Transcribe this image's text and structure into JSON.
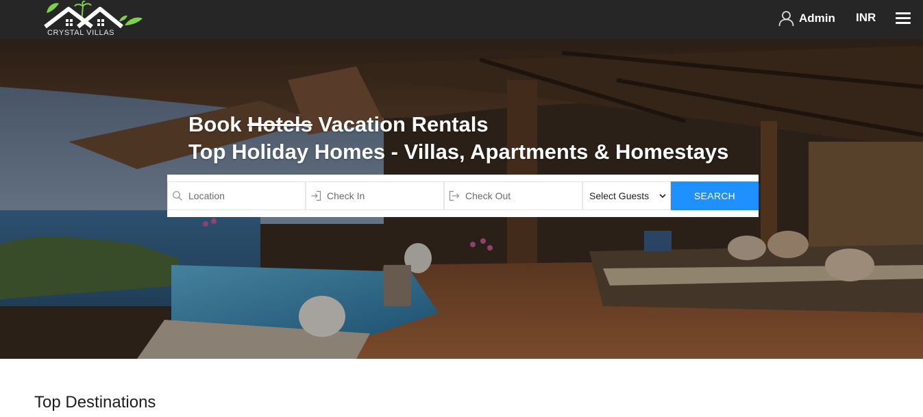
{
  "header": {
    "brand": "CRYSTAL VILLAS",
    "user_label": "Admin",
    "currency": "INR",
    "user_icon": "user-icon",
    "menu_icon": "hamburger-menu-icon"
  },
  "hero": {
    "title_word": "Book",
    "title_struck": "Hotels",
    "title_rest": "Vacation Rentals",
    "subtitle": "Top Holiday Homes - Villas, Apartments & Homestays"
  },
  "search": {
    "location_placeholder": "Location",
    "checkin_placeholder": "Check In",
    "checkout_placeholder": "Check Out",
    "guests_selected": "Select Guests",
    "button_label": "SEARCH",
    "location_icon": "search-icon",
    "checkin_icon": "sign-in-icon",
    "checkout_icon": "sign-out-icon"
  },
  "sections": {
    "top_destinations": "Top Destinations"
  },
  "colors": {
    "topbar": "#262626",
    "accent": "#1e90ff",
    "logo_green": "#7ed24a"
  }
}
